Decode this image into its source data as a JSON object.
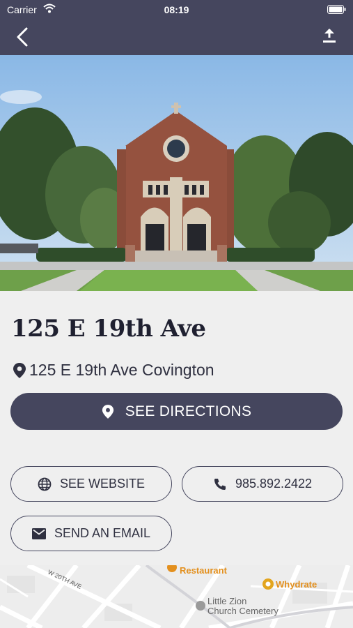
{
  "status_bar": {
    "carrier": "Carrier",
    "time": "08:19"
  },
  "nav": {
    "back_icon": "chevron-left-icon",
    "share_icon": "share-upload-icon"
  },
  "place": {
    "title": "125 E 19th Ave",
    "address": "125 E 19th Ave Covington"
  },
  "actions": {
    "directions": "SEE DIRECTIONS",
    "website": "SEE WEBSITE",
    "phone": "985.892.2422",
    "email": "SEND AN EMAIL"
  },
  "map": {
    "street_label": "W 20TH AVE",
    "poi_1": "Restaurant",
    "poi_2": "Whydrate",
    "poi_3_line1": "Little Zion",
    "poi_3_line2": "Church Cemetery"
  },
  "colors": {
    "brand": "#45465e",
    "background": "#efefef",
    "poi": "#e3901e"
  }
}
